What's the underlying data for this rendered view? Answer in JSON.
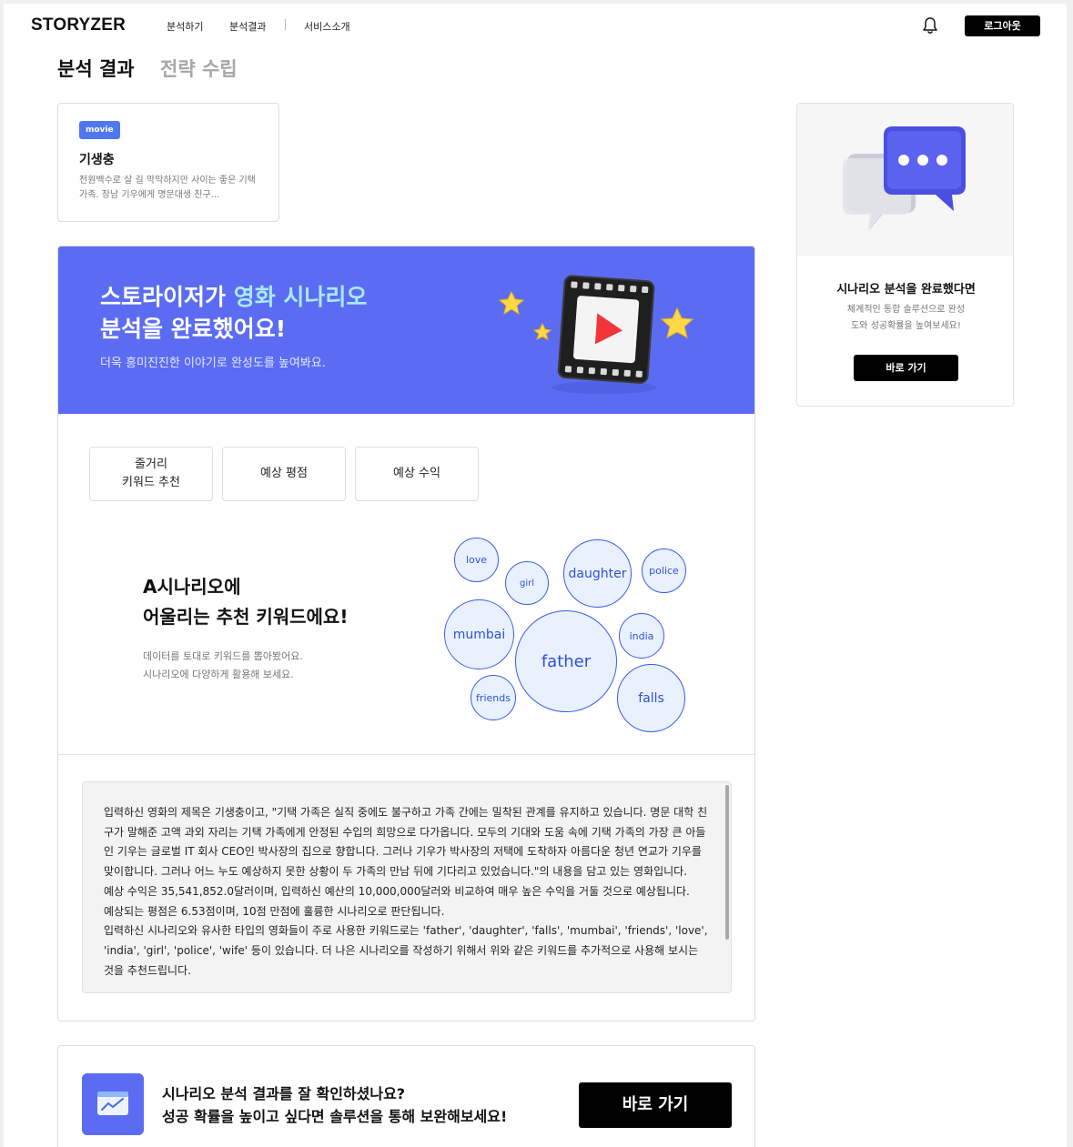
{
  "header": {
    "logo": "STORYZER",
    "nav": [
      "분석하기",
      "분석결과",
      "서비스소개"
    ],
    "logout_label": "로그아웃"
  },
  "page_tabs": {
    "active": "분석 결과",
    "inactive": "전략 수립"
  },
  "movie": {
    "badge": "movie",
    "title": "기생충",
    "description": "전원백수로 살 길 막막하지만 사이는 좋은 기택 가족. 장남 기우에게 명문대생 친구..."
  },
  "banner": {
    "title_line1_prefix": "스토라이저가 ",
    "title_line1_highlight": "영화 시나리오",
    "title_line2": "분석을 완료했어요!",
    "subtitle": "더욱 흥미진진한 이야기로 완성도를 높여봐요."
  },
  "result_tabs": [
    {
      "line1": "줄거리",
      "line2": "키워드 추천"
    },
    {
      "line1": "예상 평점",
      "line2": ""
    },
    {
      "line1": "예상 수익",
      "line2": ""
    }
  ],
  "keywords": {
    "title_line1": "A시나리오에",
    "title_line2": "어울리는 추천 키워드에요!",
    "desc_line1": "데이터를 토대로 키워드를 뽑아봤어요.",
    "desc_line2": "시나리오에 다양하게 활용해 보세요.",
    "items": [
      "love",
      "girl",
      "daughter",
      "police",
      "mumbai",
      "father",
      "india",
      "friends",
      "falls"
    ]
  },
  "analysis_text": {
    "p1": "입력하신 영화의 제목은 기생충이고, \"기택 가족은 실직 중에도 불구하고 가족 간에는 밀착된 관계를 유지하고 있습니다. 명문 대학 친구가 말해준 고액 과외 자리는 기택 가족에게 안정된 수입의 희망으로 다가옵니다. 모두의 기대와 도움 속에 기택 가족의 가장 큰 아들인 기우는 글로벌 IT 회사 CEO인 박사장의 집으로 향합니다. 그러나 기우가 박사장의 저택에 도착하자 아름다운 청년 연교가 기우를 맞이합니다. 그러나 어느 누도 예상하지 못한 상황이 두 가족의 만남 뒤에 기다리고 있었습니다.\"의 내용을 담고 있는 영화입니다.",
    "p2": "예상 수익은 35,541,852.0달러이며, 입력하신 예산의 10,000,000달러와 비교하여 매우 높은 수익을 거둘 것으로 예상됩니다.",
    "p3": "예상되는 평점은 6.53점이며, 10점 만점에 훌륭한 시나리오로 판단됩니다.",
    "p4": "입력하신 시나리오와 유사한 타입의 영화들이 주로 사용한 키워드로는 'father', 'daughter', 'falls', 'mumbai', 'friends', 'love', 'india', 'girl', 'police', 'wife' 등이 있습니다. 더 나은 시나리오를 작성하기 위해서 위와 같은 키워드를 추가적으로 사용해 보시는 것을 추천드립니다."
  },
  "bottom_cta": {
    "line1": "시나리오 분석 결과를 잘 확인하셨나요?",
    "line2": "성공 확률을 높이고 싶다면 솔루션을 통해 보완해보세요!",
    "button": "바로 가기"
  },
  "side_card": {
    "title": "시나리오 분석을 완료했다면",
    "desc_line1": "체계적인 통합 솔루션으로 완성",
    "desc_line2": "도와 성공확률을 높여보세요!",
    "button": "바로 가기"
  },
  "colors": {
    "accent": "#5b6cf3",
    "badge": "#4f78f0",
    "bubble_fill": "#e9f1ff",
    "bubble_stroke": "#3a5ce8"
  }
}
